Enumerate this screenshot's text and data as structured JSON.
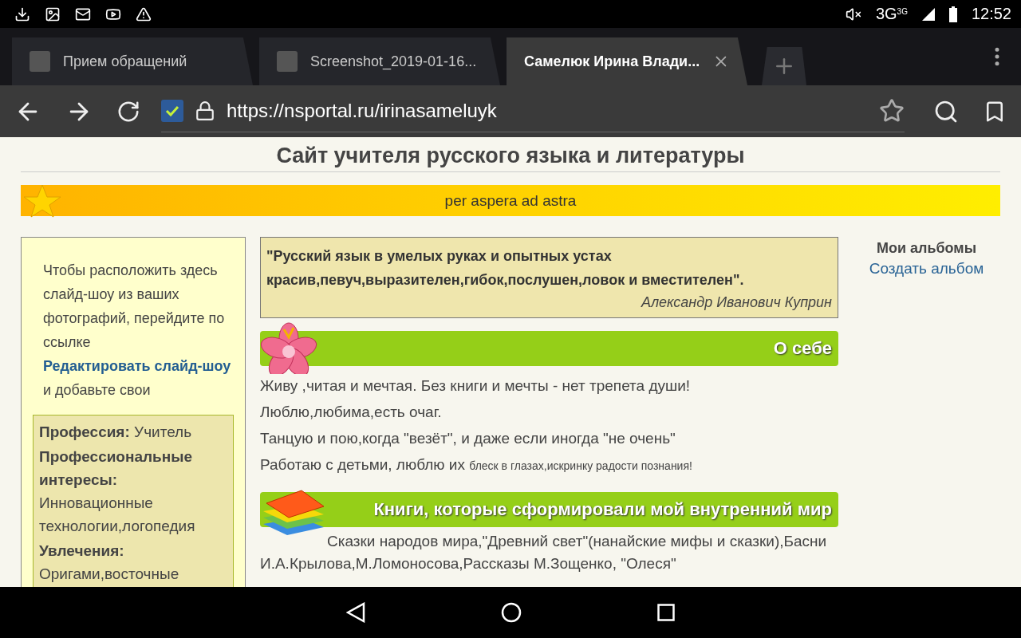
{
  "status_bar": {
    "network": "3G",
    "network_small": "3G",
    "time": "12:52"
  },
  "browser": {
    "tabs": [
      {
        "title": "Прием обращений",
        "selected": false
      },
      {
        "title": "Screenshot_2019-01-16...",
        "selected": false
      },
      {
        "title": "Самелюк Ирина Влади...",
        "selected": true
      }
    ],
    "url": "https://nsportal.ru/irinasameluyk"
  },
  "page": {
    "title": "Сайт учителя русского языка и литературы",
    "motto": "per aspera ad astra",
    "sidebar": {
      "intro": "Чтобы расположить здесь слайд-шоу из ваших фотографий, перейдите по ссылке",
      "link": "Редактировать слайд-шоу",
      "intro_end": "и добавьте свои",
      "profile": [
        "**Профессия:** Учитель",
        "**Профессиональные интересы:** Инновационные технологии,логопедия",
        "**Увлечения:** Оригами,восточные"
      ]
    },
    "quote": {
      "text": "\"Русский язык в умелых руках и опытных устах красив,певуч,выразителен,гибок,послушен,ловок и вместителен\".",
      "author": "Александр Иванович Куприн"
    },
    "sections": [
      {
        "kind": "flower",
        "title": "О себе",
        "lines": [
          {
            "text": "Живу ,читая и мечтая. Без книги и мечты - нет трепета души!"
          },
          {
            "text": "Люблю,любима,есть очаг."
          },
          {
            "text": "Танцую и пою,когда \"везёт\", и даже если иногда \"не очень\""
          },
          {
            "text": "Работаю с детьми, люблю их",
            "small": "блеск в глазах,искринку радости познания!"
          }
        ]
      },
      {
        "kind": "books",
        "title": "Книги, которые сформировали мой внутренний мир",
        "lines": [
          {
            "text": "Сказки народов мира,\"Древний свет\"(нанайские мифы и сказки),Басни И.А.Крылова,М.Ломоносова,Рассказы М.Зощенко, \"Олеся\""
          }
        ]
      }
    ],
    "albums": {
      "heading": "Мои альбомы",
      "link": "Создать альбом"
    }
  }
}
